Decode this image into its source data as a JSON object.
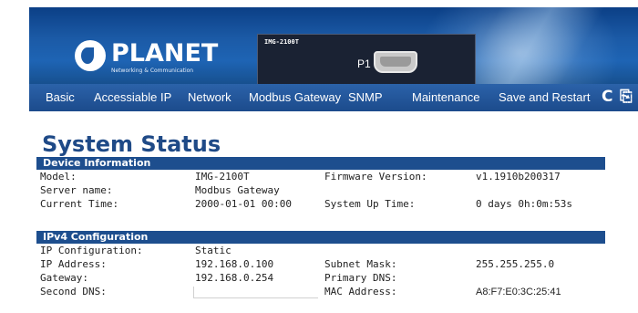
{
  "header": {
    "logo_text": "PLANET",
    "logo_tagline": "Networking & Communication",
    "device_model": "IMG-2100T",
    "port_label": "P1"
  },
  "nav": {
    "items": [
      "Basic",
      "Accessiable IP",
      "Network",
      "Modbus Gateway",
      "SNMP",
      "Maintenance",
      "Save and Restart"
    ],
    "refresh_icon": "C",
    "logout_icon": "exit-icon"
  },
  "page": {
    "title": "System Status"
  },
  "device_info": {
    "title": "Device Information",
    "rows": [
      {
        "label": "Model:",
        "value": "IMG-2100T",
        "label2": "Firmware Version:",
        "value2": "v1.1910b200317"
      },
      {
        "label": "Server name:",
        "value": "Modbus Gateway",
        "label2": "",
        "value2": ""
      },
      {
        "label": "Current Time:",
        "value": "2000-01-01 00:00",
        "label2": "System Up Time:",
        "value2": "0 days 0h:0m:53s"
      }
    ]
  },
  "ipv4": {
    "title": "IPv4 Configuration",
    "rows": [
      {
        "label": "IP Configuration:",
        "value": "Static",
        "label2": "",
        "value2": ""
      },
      {
        "label": "IP Address:",
        "value": "192.168.0.100",
        "label2": "Subnet Mask:",
        "value2": "255.255.255.0"
      },
      {
        "label": "Gateway:",
        "value": "192.168.0.254",
        "label2": "Primary DNS:",
        "value2": ""
      },
      {
        "label": "Second DNS:",
        "value": "",
        "label2": "MAC Address:",
        "value2": "A8:F7:E0:3C:25:41"
      }
    ]
  }
}
